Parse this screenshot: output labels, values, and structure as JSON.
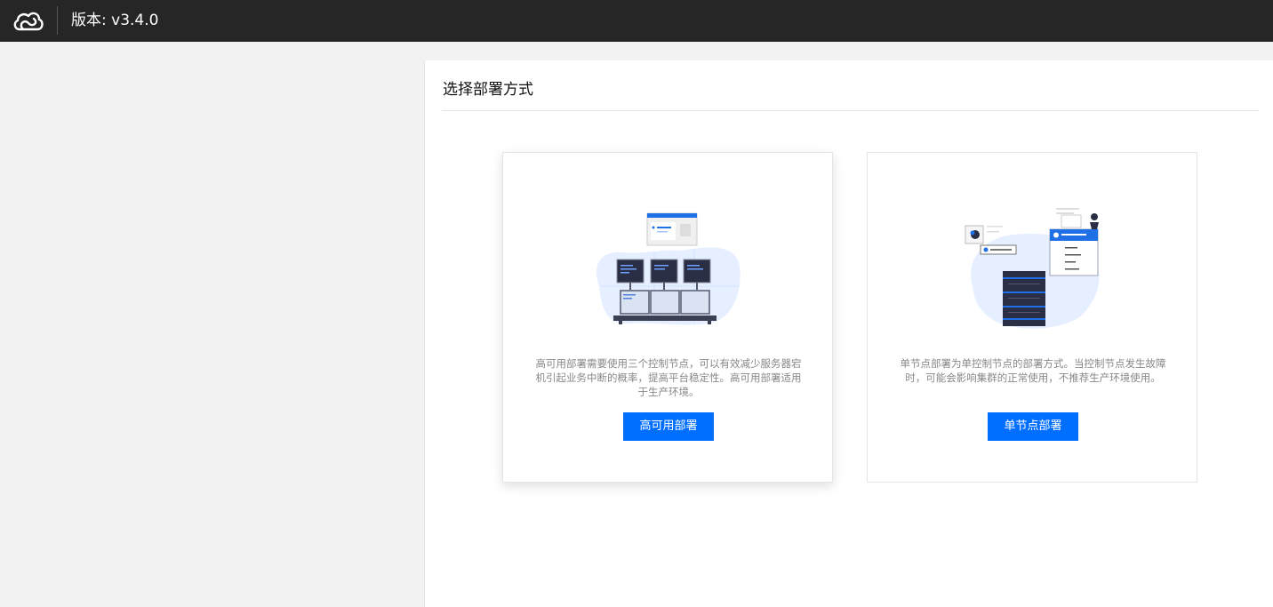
{
  "header": {
    "logo_icon": "cloud-logo-icon",
    "version_label": "版本: v3.4.0"
  },
  "main": {
    "title": "选择部署方式",
    "cards": [
      {
        "icon": "control-room-illustration",
        "description": "高可用部署需要使用三个控制节点，可以有效减少服务器宕机引起业务中断的概率，提高平台稳定性。高可用部署适用于生产环境。",
        "button_label": "高可用部署"
      },
      {
        "icon": "server-rack-illustration",
        "description": "单节点部署为单控制节点的部署方式。当控制节点发生故障时，可能会影响集群的正常使用，不推荐生产环境使用。",
        "button_label": "单节点部署"
      }
    ]
  },
  "colors": {
    "topbar": "#262626",
    "accent": "#006eff",
    "background": "#f2f2f2"
  }
}
